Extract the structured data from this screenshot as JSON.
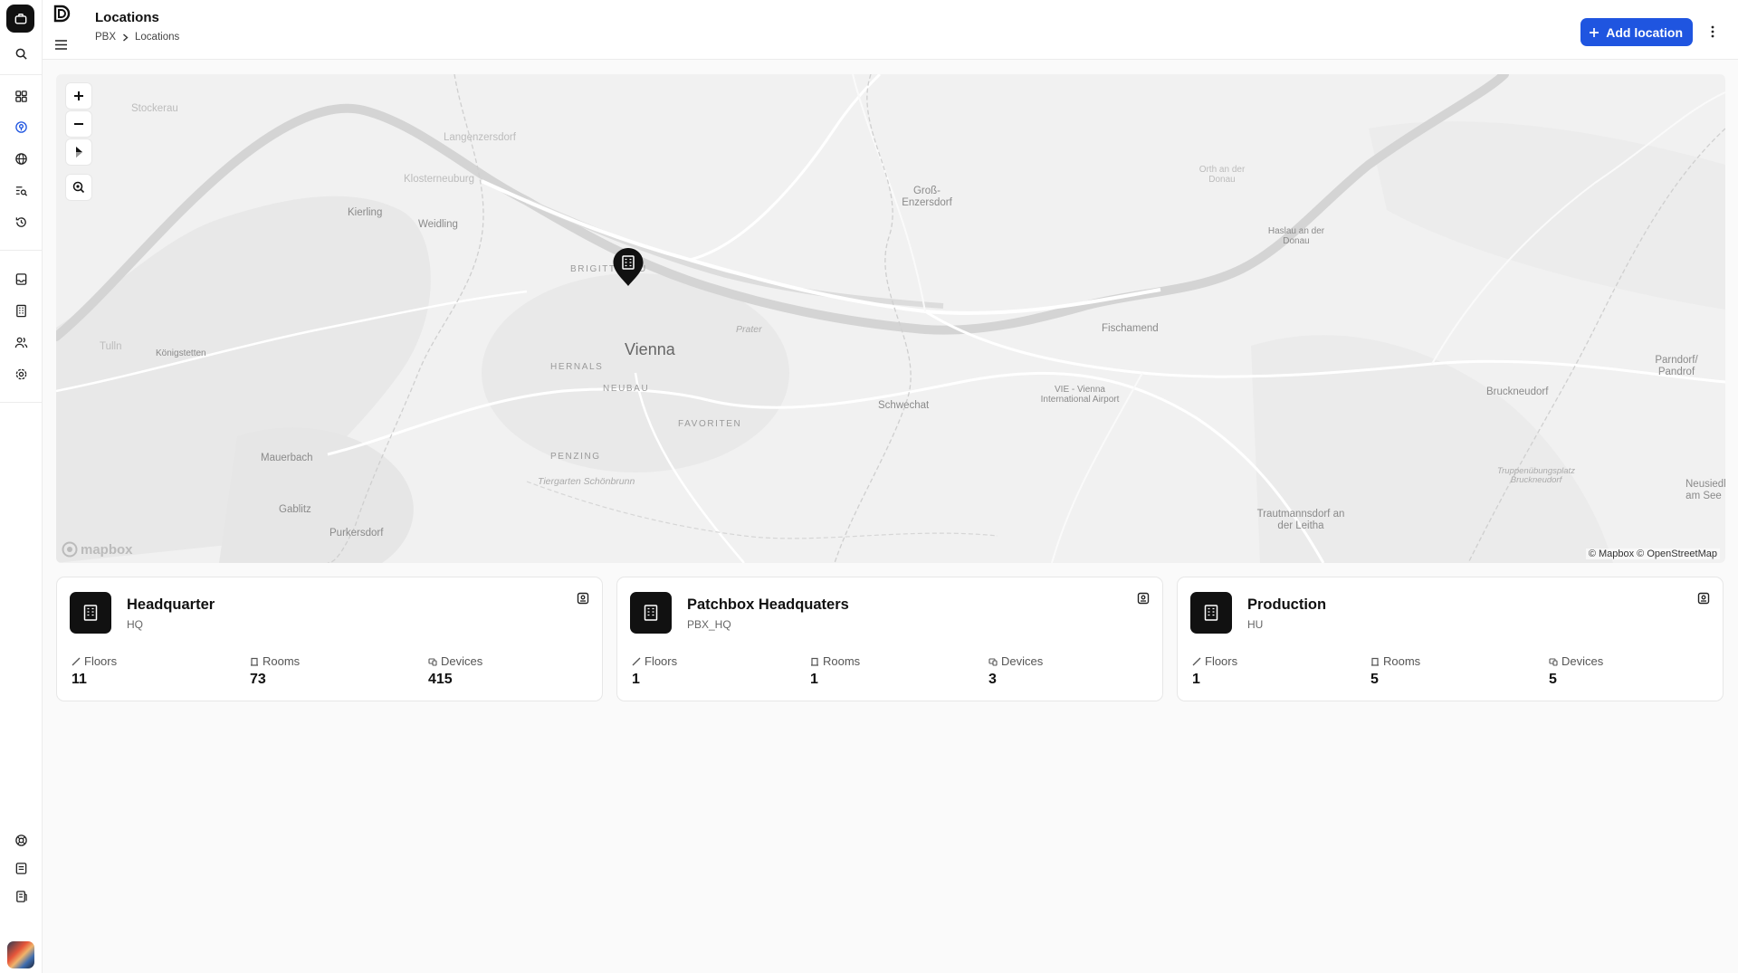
{
  "header": {
    "title": "Locations",
    "breadcrumb": [
      "PBX",
      "Locations"
    ],
    "add_button": "Add location"
  },
  "rail": {
    "top_icons": [
      "search-icon",
      "dashboard-icon",
      "location-icon",
      "globe-icon",
      "search-list-icon",
      "history-icon"
    ],
    "mid_icons": [
      "inbox-icon",
      "building-icon",
      "users-icon",
      "settings-icon"
    ],
    "bottom_icons": [
      "help-icon",
      "docs-icon",
      "notes-icon"
    ],
    "active": "location-icon"
  },
  "map": {
    "city": "Vienna",
    "places": [
      "Stockerau",
      "Langenzersdorf",
      "Klosterneuburg",
      "Kierling",
      "Weidling",
      "Groß-Enzersdorf",
      "Orth an der Donau",
      "Haslau an der Donau",
      "Fischamend",
      "Schwechat",
      "VIE - Vienna International Airport",
      "Bruckneudorf",
      "Parndorf/ Pandrof",
      "Tulln",
      "Königstetten",
      "Mauerbach",
      "Gablitz",
      "Purkersdorf",
      "Trautmannsdorf an der Leitha",
      "Neusiedl am See"
    ],
    "districts": [
      "BRIGITTENAU",
      "HERNALS",
      "NEUBAU",
      "FAVORITEN",
      "PENZING"
    ],
    "parks": [
      "Prater",
      "Tiergarten Schönbrunn",
      "Truppenübungsplatz Bruckneudorf"
    ],
    "attribution": "© Mapbox © OpenStreetMap",
    "provider": "mapbox"
  },
  "stat_labels": {
    "floors": "Floors",
    "rooms": "Rooms",
    "devices": "Devices"
  },
  "locations": [
    {
      "name": "Headquarter",
      "code": "HQ",
      "floors": "11",
      "rooms": "73",
      "devices": "415"
    },
    {
      "name": "Patchbox Headquaters",
      "code": "PBX_HQ",
      "floors": "1",
      "rooms": "1",
      "devices": "3"
    },
    {
      "name": "Production",
      "code": "HU",
      "floors": "1",
      "rooms": "5",
      "devices": "5"
    }
  ],
  "colors": {
    "accent": "#1f55e0",
    "pin": "#111111",
    "map_bg": "#f1f1f1"
  }
}
